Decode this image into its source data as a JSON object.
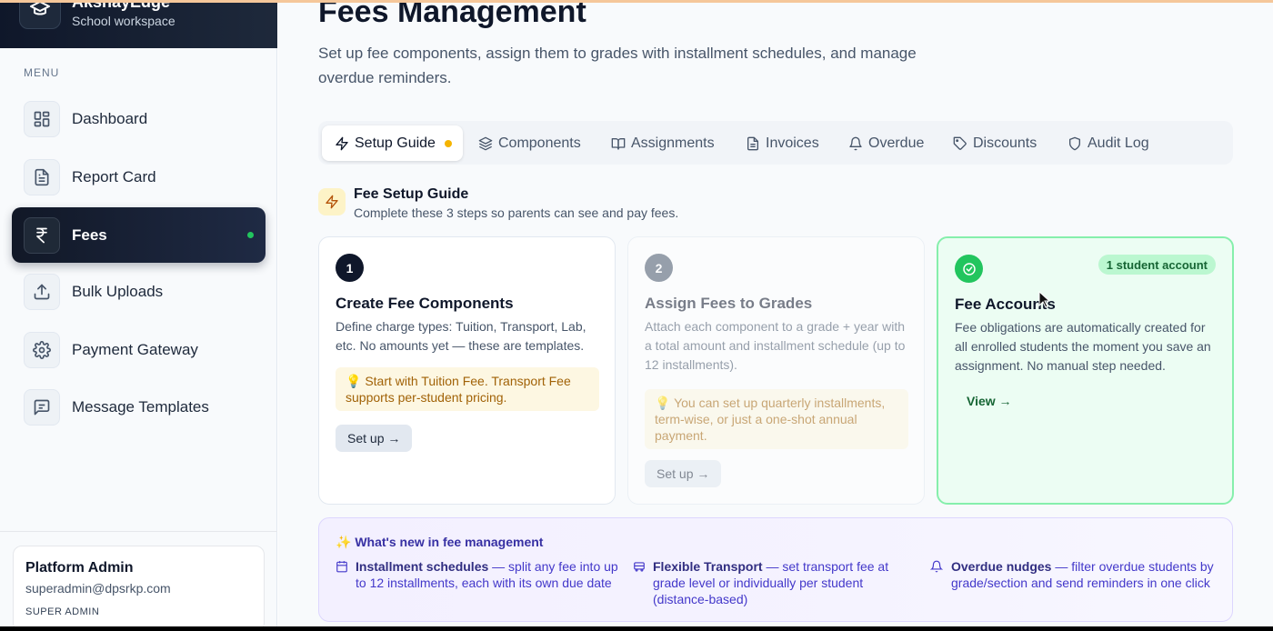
{
  "brand": {
    "name": "AkshayEdge",
    "subtitle": "School workspace"
  },
  "sidebar": {
    "menu_label": "MENU",
    "items": [
      {
        "label": "Dashboard",
        "icon": "dashboard-icon"
      },
      {
        "label": "Report Card",
        "icon": "document-icon"
      },
      {
        "label": "Fees",
        "icon": "rupee-icon",
        "active": true
      },
      {
        "label": "Bulk Uploads",
        "icon": "upload-icon"
      },
      {
        "label": "Payment Gateway",
        "icon": "gear-icon"
      },
      {
        "label": "Message Templates",
        "icon": "message-icon"
      }
    ]
  },
  "user": {
    "name": "Platform Admin",
    "email": "superadmin@dpsrkp.com",
    "role": "SUPER ADMIN"
  },
  "page": {
    "title": "Fees Management",
    "subtitle": "Set up fee components, assign them to grades with installment schedules, and manage overdue reminders."
  },
  "tabs": [
    {
      "label": "Setup Guide",
      "icon": "bolt-icon",
      "active": true
    },
    {
      "label": "Components",
      "icon": "layers-icon"
    },
    {
      "label": "Assignments",
      "icon": "book-icon"
    },
    {
      "label": "Invoices",
      "icon": "invoice-icon"
    },
    {
      "label": "Overdue",
      "icon": "bell-icon"
    },
    {
      "label": "Discounts",
      "icon": "tag-icon"
    },
    {
      "label": "Audit Log",
      "icon": "shield-icon"
    }
  ],
  "guide": {
    "title": "Fee Setup Guide",
    "subtitle": "Complete these 3 steps so parents can see and pay fees."
  },
  "cards": [
    {
      "step": "1",
      "title": "Create Fee Components",
      "description": "Define charge types: Tuition, Transport, Lab, etc. No amounts yet — these are templates.",
      "tip": "💡 Start with Tuition Fee. Transport Fee supports per-student pricing.",
      "button": "Set up →"
    },
    {
      "step": "2",
      "title": "Assign Fees to Grades",
      "description": "Attach each component to a grade + year with a total amount and installment schedule (up to 12 installments).",
      "tip": "💡 You can set up quarterly installments, term-wise, or just a one-shot annual payment.",
      "button": "Set up →"
    },
    {
      "title": "Fee Accounts",
      "badge": "1 student account",
      "description": "Fee obligations are automatically created for all enrolled students the moment you save an assignment. No manual step needed.",
      "link": "View →"
    }
  ],
  "whats_new": {
    "title": "✨ What's new in fee management",
    "items": [
      {
        "bold": "Installment schedules",
        "text": " — split any fee into up to 12 installments, each with its own due date",
        "icon": "calendar-icon"
      },
      {
        "bold": "Flexible Transport",
        "text": " — set transport fee at grade level or individually per student (distance-based)",
        "icon": "bus-icon"
      },
      {
        "bold": "Overdue nudges",
        "text": " — filter overdue students by grade/section and send reminders in one click",
        "icon": "bell-icon"
      }
    ]
  },
  "colors": {
    "accent_dark": "#0f172a",
    "success": "#22c55e",
    "tip_bg": "#fdf7e2",
    "whatsnew_text": "#4338ca"
  }
}
